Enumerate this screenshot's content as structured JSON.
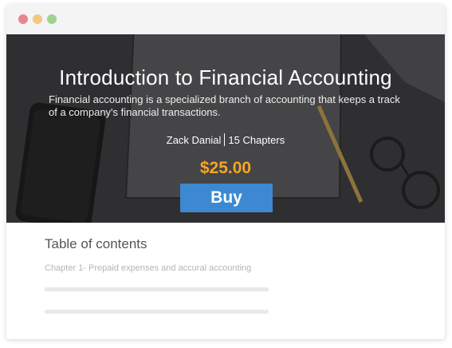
{
  "window": {
    "controls": [
      "close",
      "minimize",
      "maximize"
    ]
  },
  "book": {
    "title": "Introduction to Financial Accounting",
    "description": "Financial accounting is a specialized branch of accounting that keeps a track of a company's financial transactions.",
    "author": "Zack Danial",
    "chapters": "15 Chapters",
    "price": "$25.00",
    "buy_label": "Buy"
  },
  "toc": {
    "heading": "Table of contents",
    "chapter_1": "Chapter 1- Prepaid expenses and accural accounting"
  },
  "colors": {
    "accent": "#3c89d1",
    "price": "#f5a623"
  }
}
